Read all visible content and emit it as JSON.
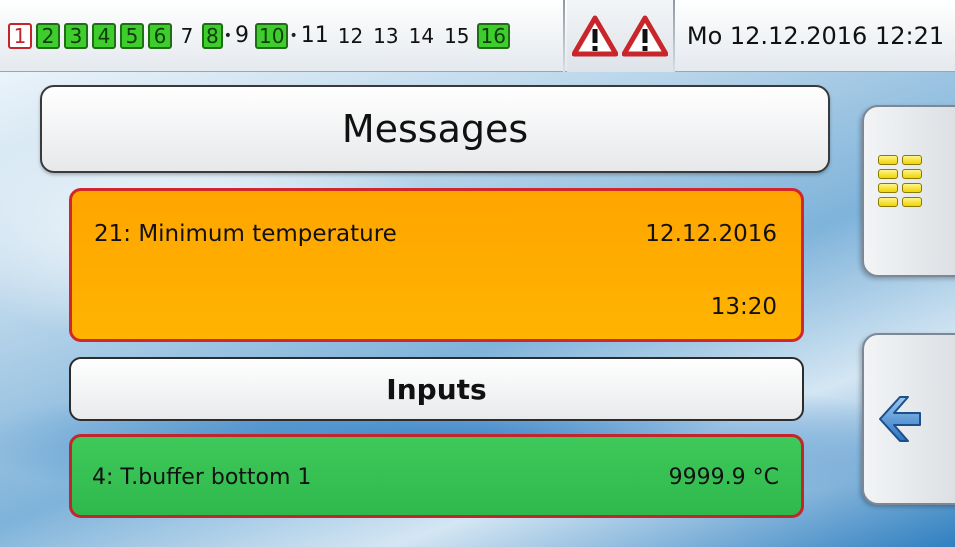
{
  "status_bar": {
    "outputs": [
      {
        "label": "1",
        "state": "red",
        "kind": "single"
      },
      {
        "label": "2",
        "state": "green",
        "kind": "single"
      },
      {
        "label": "3",
        "state": "green",
        "kind": "single"
      },
      {
        "label": "4",
        "state": "green",
        "kind": "single"
      },
      {
        "label": "5",
        "state": "green",
        "kind": "single"
      },
      {
        "label": "6",
        "state": "green",
        "kind": "single"
      },
      {
        "label": "7",
        "state": "off",
        "kind": "single"
      },
      {
        "label": "8",
        "pair_with": "9",
        "state": "first-green",
        "kind": "pair"
      },
      {
        "label": "10",
        "pair_with": "11",
        "state": "first-green",
        "kind": "pair"
      },
      {
        "label": "12",
        "state": "off",
        "kind": "single"
      },
      {
        "label": "13",
        "state": "off",
        "kind": "single"
      },
      {
        "label": "14",
        "state": "off",
        "kind": "single"
      },
      {
        "label": "15",
        "state": "off",
        "kind": "single"
      },
      {
        "label": "16",
        "state": "green",
        "kind": "single"
      }
    ],
    "warning_icons": [
      "warning-triangle-icon",
      "warning-triangle-icon"
    ],
    "datetime": "Mo 12.12.2016 12:21"
  },
  "title": "Messages",
  "message": {
    "text": "21: Minimum temperature",
    "date": "12.12.2016",
    "time": "13:20",
    "color": "#ffa500"
  },
  "inputs_section": {
    "label": "Inputs",
    "item": {
      "text": "4: T.buffer bottom 1",
      "value": "9999.9 °C",
      "color": "#33c050"
    }
  },
  "side_buttons": {
    "menu_icon": "menu-grid-icon",
    "back_icon": "back-arrow-icon"
  },
  "colors": {
    "alert_border": "#d1262b",
    "output_green": "#3fcc2d"
  }
}
